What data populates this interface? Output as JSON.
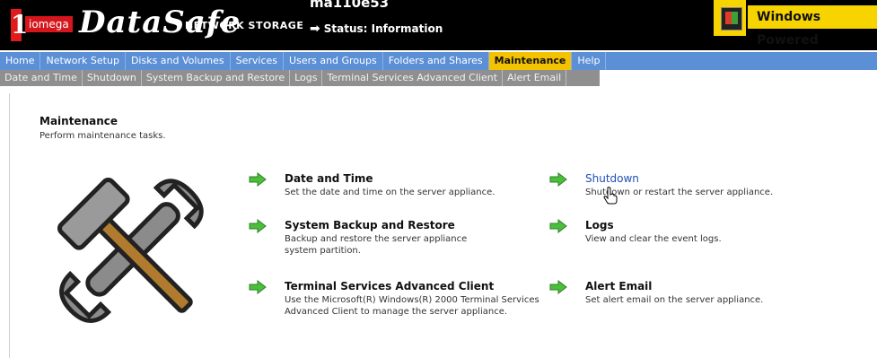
{
  "header": {
    "brand": "DataSafe",
    "logo_iomega": "iomega",
    "brand_sub": "NETWORK STORAGE",
    "server_name": "ma110e53",
    "status_text": "Status: Information",
    "windows_badge": "Windows Powered"
  },
  "nav": {
    "main_tabs": [
      "Home",
      "Network Setup",
      "Disks and Volumes",
      "Services",
      "Users and Groups",
      "Folders and Shares",
      "Maintenance",
      "Help"
    ],
    "active_tab": "Maintenance",
    "sub_tabs": [
      "Date and Time",
      "Shutdown",
      "System Backup and Restore",
      "Logs",
      "Terminal Services Advanced Client",
      "Alert Email"
    ]
  },
  "page": {
    "title": "Maintenance",
    "subtitle": "Perform maintenance tasks."
  },
  "tasks": [
    {
      "name": "Date and Time",
      "desc": "Set the date and time on the server appliance."
    },
    {
      "name": "System Backup and Restore",
      "desc": "Backup and restore the server appliance system partition."
    },
    {
      "name": "Terminal Services Advanced Client",
      "desc": "Use the Microsoft(R) Windows(R) 2000 Terminal Services Advanced Client to manage the server appliance."
    },
    {
      "name": "Shutdown",
      "desc": "Shutdown or restart the server appliance."
    },
    {
      "name": "Logs",
      "desc": "View and clear the event logs."
    },
    {
      "name": "Alert Email",
      "desc": "Set alert email on the server appliance."
    }
  ],
  "colors": {
    "nav_blue": "#5b8fd6",
    "active_tab": "#f3c200",
    "subnav_gray": "#8f8f8f",
    "link_blue": "#1f4fb6",
    "arrow_green": "#4bbf3c"
  },
  "icons": {
    "tools": "hammer-and-wrench-icon",
    "task_go": "green-arrow-icon",
    "cursor": "hand-pointer-icon"
  }
}
